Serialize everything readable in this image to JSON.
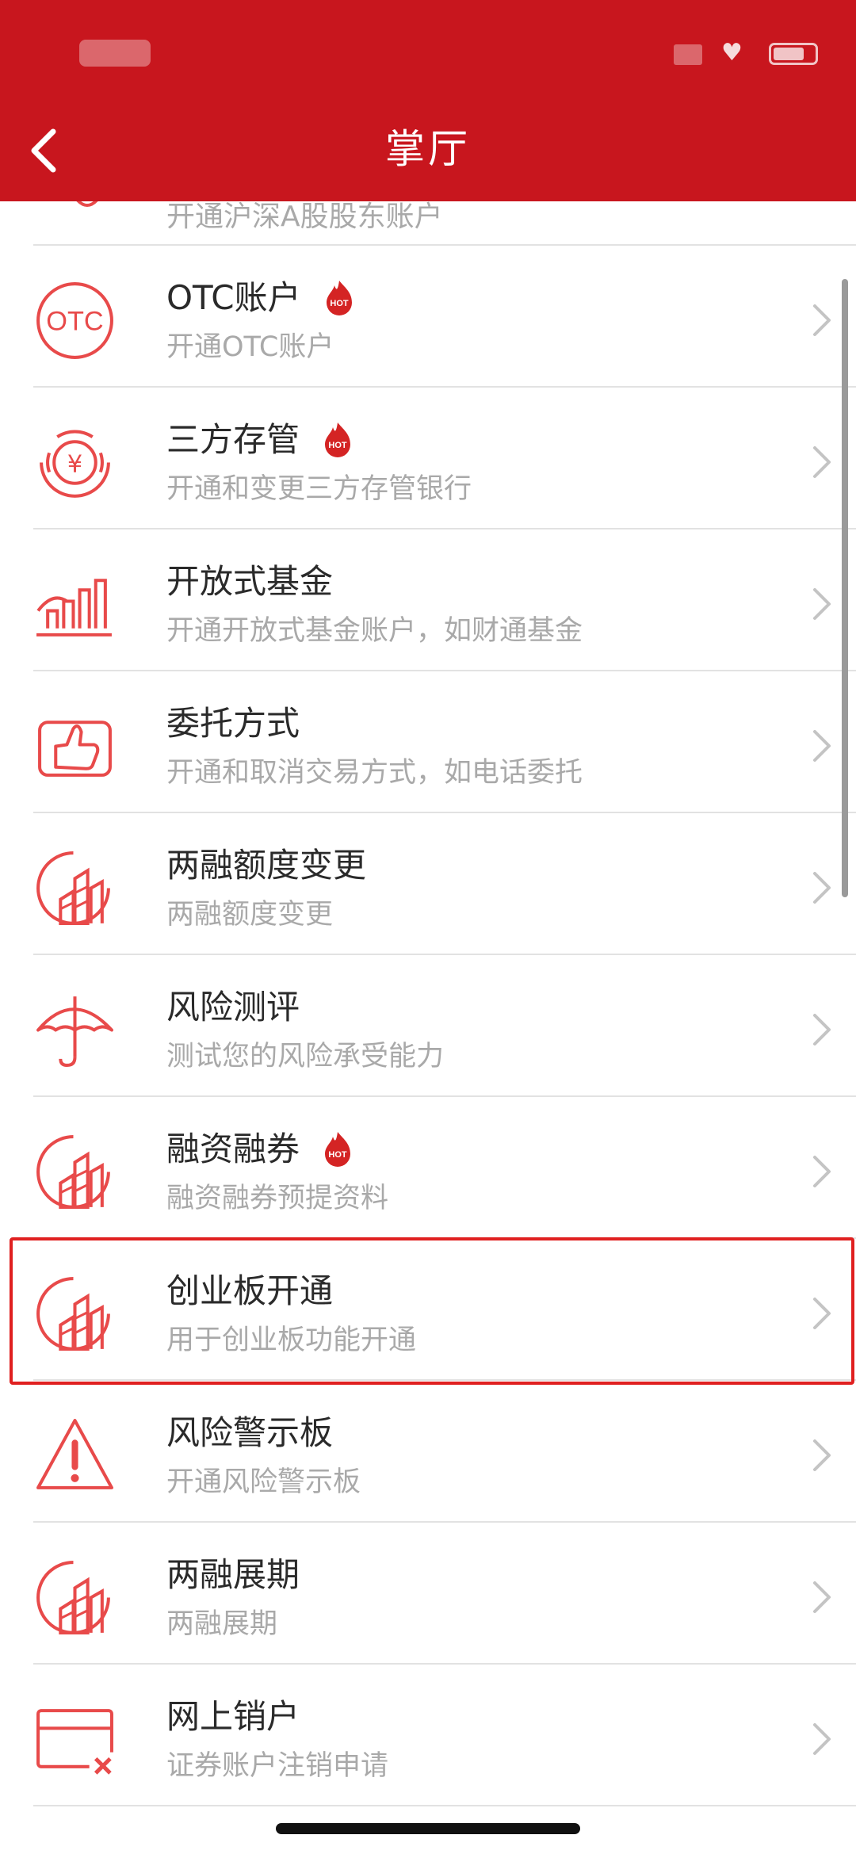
{
  "header": {
    "title": "掌厅",
    "back_icon": "chevron-left-icon",
    "background": "#c8161e"
  },
  "partial_row": {
    "subtitle": "开通沪深A股股东账户"
  },
  "items": [
    {
      "title": "OTC账户",
      "subtitle": "开通OTC账户",
      "hot": true,
      "icon": "otc-icon"
    },
    {
      "title": "三方存管",
      "subtitle": "开通和变更三方存管银行",
      "hot": true,
      "icon": "yen-icon"
    },
    {
      "title": "开放式基金",
      "subtitle": "开通开放式基金账户，如财通基金",
      "hot": false,
      "icon": "bar-chart-icon"
    },
    {
      "title": "委托方式",
      "subtitle": "开通和取消交易方式，如电话委托",
      "hot": false,
      "icon": "thumbs-up-icon"
    },
    {
      "title": "两融额度变更",
      "subtitle": "两融额度变更",
      "hot": false,
      "icon": "building-chart-icon"
    },
    {
      "title": "风险测评",
      "subtitle": "测试您的风险承受能力",
      "hot": false,
      "icon": "umbrella-icon"
    },
    {
      "title": "融资融券",
      "subtitle": "融资融券预提资料",
      "hot": true,
      "icon": "building-chart-icon"
    },
    {
      "title": "创业板开通",
      "subtitle": "用于创业板功能开通",
      "hot": false,
      "icon": "building-chart-icon",
      "highlighted": true
    },
    {
      "title": "风险警示板",
      "subtitle": "开通风险警示板",
      "hot": false,
      "icon": "warning-icon"
    },
    {
      "title": "两融展期",
      "subtitle": "两融展期",
      "hot": false,
      "icon": "building-chart-icon"
    },
    {
      "title": "网上销户",
      "subtitle": "证券账户注销申请",
      "hot": false,
      "icon": "cancel-card-icon"
    }
  ],
  "hot_badge_text": "HOT",
  "accent_color": "#e84a4a"
}
